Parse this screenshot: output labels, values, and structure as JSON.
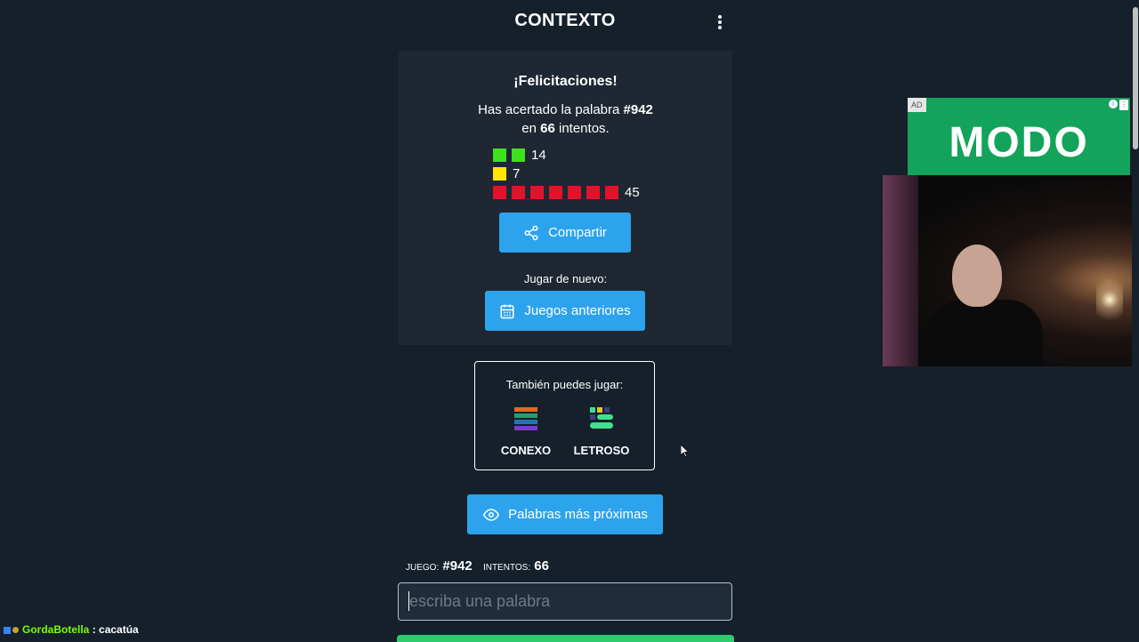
{
  "header": {
    "title": "CONTEXTO"
  },
  "result": {
    "congrats": "¡Felicitaciones!",
    "line1_prefix": "Has acertado la palabra ",
    "word_number": "#942",
    "line2_prefix": "en ",
    "attempts": "66",
    "line2_suffix": " intentos.",
    "stats": [
      {
        "color": "green",
        "squares": 2,
        "count": "14"
      },
      {
        "color": "yellow",
        "squares": 1,
        "count": "7"
      },
      {
        "color": "red",
        "squares": 7,
        "count": "45"
      }
    ],
    "share_label": "Compartir",
    "play_again_label": "Jugar de nuevo:",
    "previous_games_label": "Juegos anteriores"
  },
  "also_play": {
    "title": "También puedes jugar:",
    "games": [
      "CONEXO",
      "LETROSO"
    ]
  },
  "closest_words_label": "Palabras más próximas",
  "game_info": {
    "game_key": "JUEGO:",
    "game_value": "#942",
    "attempts_key": "INTENTOS:",
    "attempts_value": "66"
  },
  "input": {
    "placeholder": "escriba una palabra"
  },
  "chat": {
    "user": "GordaBotella",
    "separator": " : ",
    "message": "cacatúa"
  },
  "ad": {
    "tag": "AD",
    "brand": "MODO"
  },
  "colors": {
    "background": "#15202b",
    "card": "#1e2732",
    "button": "#2da3ee",
    "green": "#3ee21c",
    "yellow": "#ffe800",
    "red": "#e5112a"
  }
}
